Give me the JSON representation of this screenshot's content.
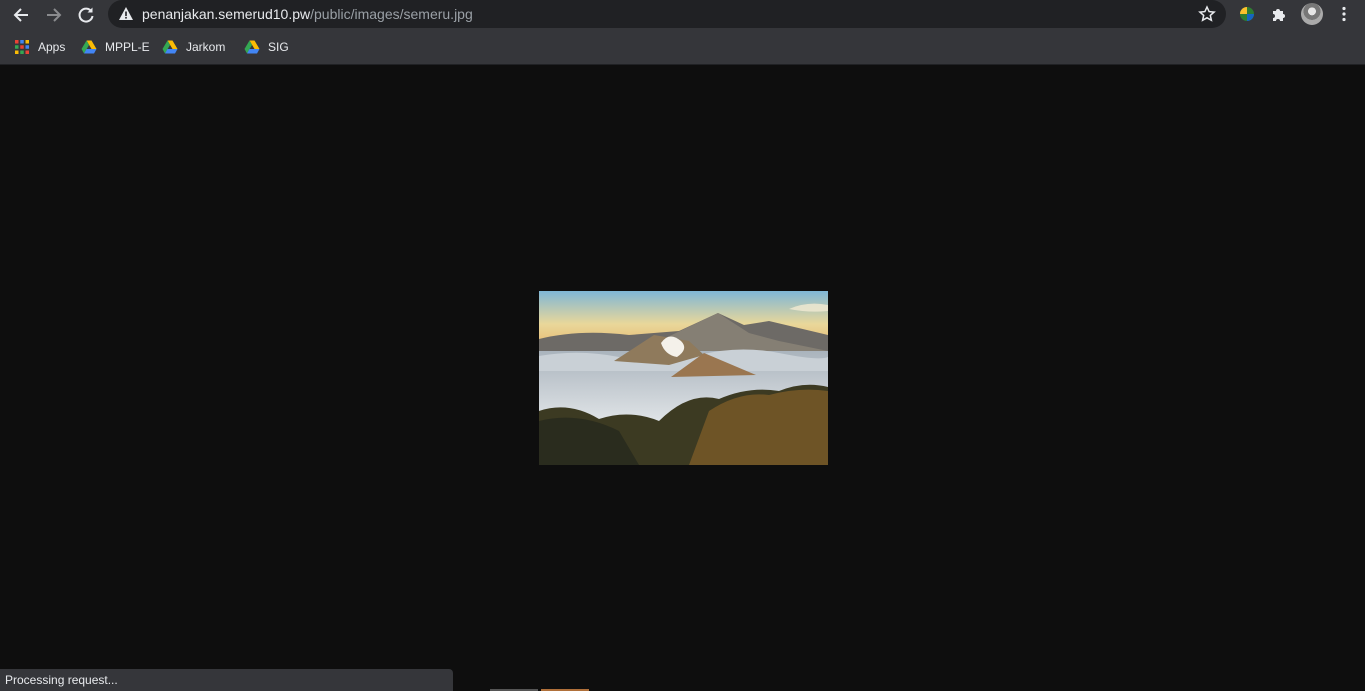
{
  "browser": {
    "url_host": "penanjakan.semerud10.pw",
    "url_path": "/public/images/semeru.jpg"
  },
  "bookmarks": [
    {
      "label": "Apps",
      "icon": "apps-grid-icon"
    },
    {
      "label": "MPPL-E",
      "icon": "google-drive-icon"
    },
    {
      "label": "Jarkom",
      "icon": "google-drive-icon"
    },
    {
      "label": "SIG",
      "icon": "google-drive-icon"
    }
  ],
  "status": {
    "text": "Processing request..."
  },
  "colors": {
    "toolbar": "#35363a",
    "omnibox": "#202124",
    "page_bg": "#0e0e0e"
  }
}
